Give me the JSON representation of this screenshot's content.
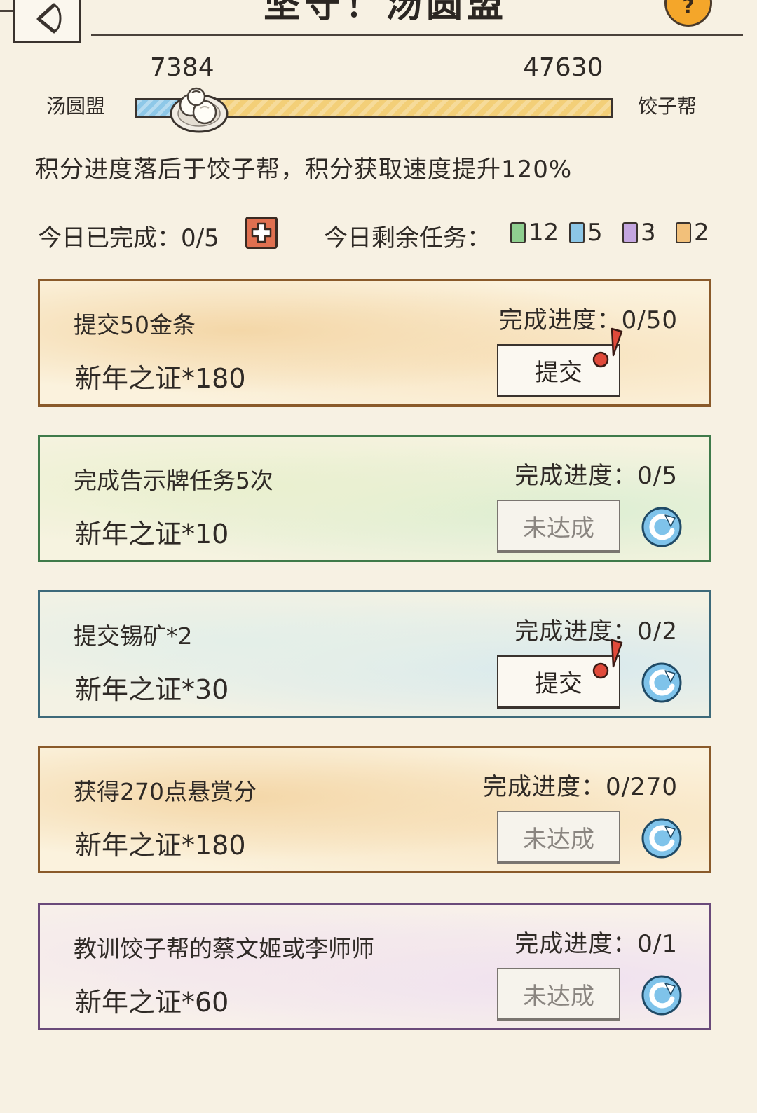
{
  "header": {
    "title": "坚守！汤圆盟",
    "help_label": "?"
  },
  "battle": {
    "left_team": "汤圆盟",
    "right_team": "饺子帮",
    "left_score": "7384",
    "right_score": "47630",
    "left_share": 0.134,
    "status_text": "积分进度落后于饺子帮，积分获取速度提升120%"
  },
  "daily": {
    "done_label": "今日已完成：0/5",
    "remain_label": "今日剩余任务：",
    "remaining": [
      {
        "count": "12",
        "color": "#8fcf8f"
      },
      {
        "count": "5",
        "color": "#8cc6e6"
      },
      {
        "count": "3",
        "color": "#c4a6e0"
      },
      {
        "count": "2",
        "color": "#f2c07a"
      }
    ]
  },
  "tasks": [
    {
      "title": "提交50金条",
      "reward": "新年之证*180",
      "progress": "完成进度：0/50",
      "button": "提交",
      "enabled": true,
      "refreshable": false,
      "theme": {
        "border": "#8a5a2a",
        "bg1": "#f8e3bf",
        "bg2": "#f4d7a8",
        "bg3": "#fbf2dd"
      }
    },
    {
      "title": "完成告示牌任务5次",
      "reward": "新年之证*10",
      "progress": "完成进度：0/5",
      "button": "未达成",
      "enabled": false,
      "refreshable": true,
      "theme": {
        "border": "#3f7a4a",
        "bg1": "#dbeed2",
        "bg2": "#eaf0cf",
        "bg3": "#f6f3e0"
      }
    },
    {
      "title": "提交锡矿*2",
      "reward": "新年之证*30",
      "progress": "完成进度：0/2",
      "button": "提交",
      "enabled": true,
      "refreshable": true,
      "theme": {
        "border": "#3d6a7a",
        "bg1": "#d7e9ee",
        "bg2": "#e4efe8",
        "bg3": "#f3f2e4"
      }
    },
    {
      "title": "获得270点悬赏分",
      "reward": "新年之证*180",
      "progress": "完成进度：0/270",
      "button": "未达成",
      "enabled": false,
      "refreshable": true,
      "theme": {
        "border": "#8a5a2a",
        "bg1": "#f8e3bf",
        "bg2": "#f4d7a8",
        "bg3": "#fbf2dd"
      }
    },
    {
      "title": "教训饺子帮的蔡文姬或李师师",
      "reward": "新年之证*60",
      "progress": "完成进度：0/1",
      "button": "未达成",
      "enabled": false,
      "refreshable": true,
      "theme": {
        "border": "#6a4a7a",
        "bg1": "#efe0f0",
        "bg2": "#f3e6ec",
        "bg3": "#f8f1ea"
      }
    }
  ]
}
